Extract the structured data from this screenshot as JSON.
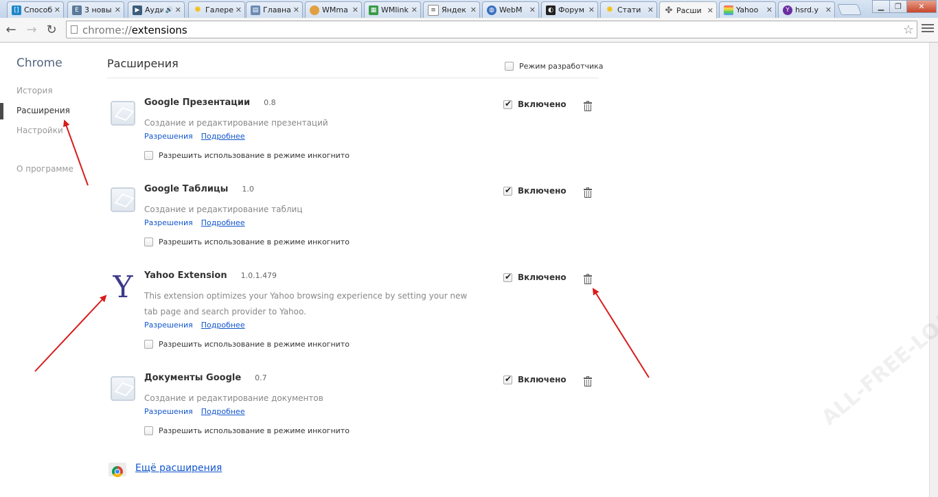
{
  "tabs": [
    {
      "title": "Способ",
      "icon": "brackets-icon",
      "color": "#1e88c8",
      "active": false
    },
    {
      "title": "3 новы",
      "icon": "letter-e-icon",
      "color": "#5a7a9a",
      "active": false
    },
    {
      "title": "Аудио",
      "icon": "play-icon",
      "color": "#3b5c7a",
      "active": false
    },
    {
      "title": "Галере",
      "icon": "sun-icon",
      "color": "#f3c21b",
      "active": false
    },
    {
      "title": "Главна",
      "icon": "window-icon",
      "color": "#6b8bb5",
      "active": false
    },
    {
      "title": "WMma",
      "icon": "orange-icon",
      "color": "#e0a040",
      "active": false
    },
    {
      "title": "WMlink",
      "icon": "map-icon",
      "color": "#3a9a4a",
      "active": false
    },
    {
      "title": "Яндек",
      "icon": "document-icon",
      "color": "#888888",
      "active": false
    },
    {
      "title": "WebM",
      "icon": "globe-icon",
      "color": "#3a6fc0",
      "active": false
    },
    {
      "title": "Форум",
      "icon": "forum-icon",
      "color": "#222222",
      "active": false
    },
    {
      "title": "Стати",
      "icon": "sun-icon",
      "color": "#f3c21b",
      "active": false
    },
    {
      "title": "Расши",
      "icon": "puzzle-icon",
      "color": "#666666",
      "active": true
    },
    {
      "title": "Yahoo",
      "icon": "rainbow-icon",
      "color": "#7aa0d0",
      "active": false
    },
    {
      "title": "hsrd.y",
      "icon": "yahoo-icon",
      "color": "#6b2ea0",
      "active": false
    }
  ],
  "address": {
    "scheme": "chrome://",
    "path": "extensions"
  },
  "sidebar": {
    "title": "Chrome",
    "items": [
      "История",
      "Расширения",
      "Настройки",
      "О программе"
    ]
  },
  "main": {
    "title": "Расширения",
    "developer_mode_label": "Режим разработчика",
    "enabled_label": "Включено",
    "permissions_label": "Разрешения",
    "details_label": "Подробнее",
    "incognito_label": "Разрешить использование в режиме инкогнито",
    "more_extensions": "Ещё расширения"
  },
  "extensions": [
    {
      "name": "Google Презентации",
      "version": "0.8",
      "description": "Создание и редактирование презентаций",
      "icon": "generic-extension-icon",
      "enabled": true,
      "incognito": false
    },
    {
      "name": "Google Таблицы",
      "version": "1.0",
      "description": "Создание и редактирование таблиц",
      "icon": "generic-extension-icon",
      "enabled": true,
      "incognito": false
    },
    {
      "name": "Yahoo Extension",
      "version": "1.0.1.479",
      "description": "This extension optimizes your Yahoo browsing experience by setting your new tab page and search provider to Yahoo.",
      "icon": "yahoo-y-icon",
      "enabled": true,
      "incognito": false
    },
    {
      "name": "Документы Google",
      "version": "0.7",
      "description": "Создание и редактирование документов",
      "icon": "generic-extension-icon",
      "enabled": true,
      "incognito": false
    }
  ],
  "watermark": "ALL-FREE-LOAD.NET",
  "colors": {
    "link": "#1155cc",
    "arrow": "#d81b1b",
    "sidebar_title": "#53637d"
  }
}
